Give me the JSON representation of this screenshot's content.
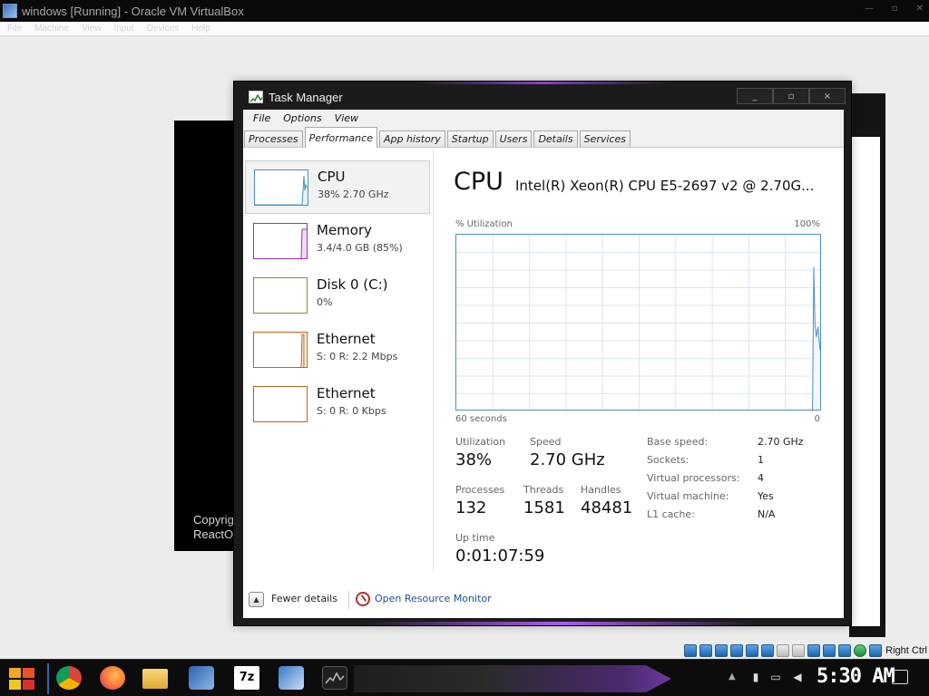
{
  "vbox": {
    "title": "windows [Running] - Oracle VM VirtualBox",
    "window_controls": [
      "—",
      "▫",
      "✕"
    ],
    "menu": [
      "File",
      "Machine",
      "View",
      "Input",
      "Devices",
      "Help"
    ],
    "host_key": "Right Ctrl"
  },
  "console": {
    "copyright_line1": "Copyrig",
    "copyright_line2": "ReactO"
  },
  "taskmgr": {
    "title": "Task Manager",
    "controls": [
      "_",
      "▫",
      "×"
    ],
    "menu": [
      "File",
      "Options",
      "View"
    ],
    "tabs": [
      "Processes",
      "Performance",
      "App history",
      "Startup",
      "Users",
      "Details",
      "Services"
    ],
    "active_tab": "Performance",
    "resources": [
      {
        "name": "CPU",
        "value": "38% 2.70 GHz",
        "color": "#4b8fc0"
      },
      {
        "name": "Memory",
        "value": "3.4/4.0 GB (85%)",
        "color": "#9b2fae"
      },
      {
        "name": "Disk 0 (C:)",
        "value": "0%",
        "color": "#6a9a2a"
      },
      {
        "name": "Ethernet",
        "value": "S: 0 R: 2.2 Mbps",
        "color": "#c2611f"
      },
      {
        "name": "Ethernet",
        "value": "S: 0 R: 0 Kbps",
        "color": "#c2611f"
      }
    ],
    "detail": {
      "title": "CPU",
      "model": "Intel(R) Xeon(R) CPU E5-2697 v2 @ 2.70G...",
      "util_label": "% Utilization",
      "util_max": "100%",
      "time_label": "60 seconds",
      "time_end": "0",
      "utilization_label": "Utilization",
      "utilization": "38%",
      "speed_label": "Speed",
      "speed": "2.70 GHz",
      "processes_label": "Processes",
      "processes": "132",
      "threads_label": "Threads",
      "threads": "1581",
      "handles_label": "Handles",
      "handles": "48481",
      "uptime_label": "Up time",
      "uptime": "0:01:07:59",
      "info": [
        {
          "label": "Base speed:",
          "value": "2.70 GHz"
        },
        {
          "label": "Sockets:",
          "value": "1"
        },
        {
          "label": "Virtual processors:",
          "value": "4"
        },
        {
          "label": "Virtual machine:",
          "value": "Yes"
        },
        {
          "label": "L1 cache:",
          "value": "N/A"
        }
      ]
    },
    "footer": {
      "fewer_details": "Fewer details",
      "open_resource_monitor": "Open Resource Monitor"
    }
  },
  "chart_data": {
    "type": "line",
    "title": "CPU",
    "xlabel": "60 seconds",
    "ylabel": "% Utilization",
    "ylim": [
      0,
      100
    ],
    "xlim": [
      60,
      0
    ],
    "series": [
      {
        "x": [
          60,
          1.5,
          1.4,
          1.2,
          1.0,
          0.8,
          0.5,
          0.2,
          0
        ],
        "values": [
          0,
          0,
          0,
          82,
          50,
          42,
          48,
          35,
          38
        ]
      }
    ]
  },
  "taskbar": {
    "clock": "5:30 AM"
  }
}
